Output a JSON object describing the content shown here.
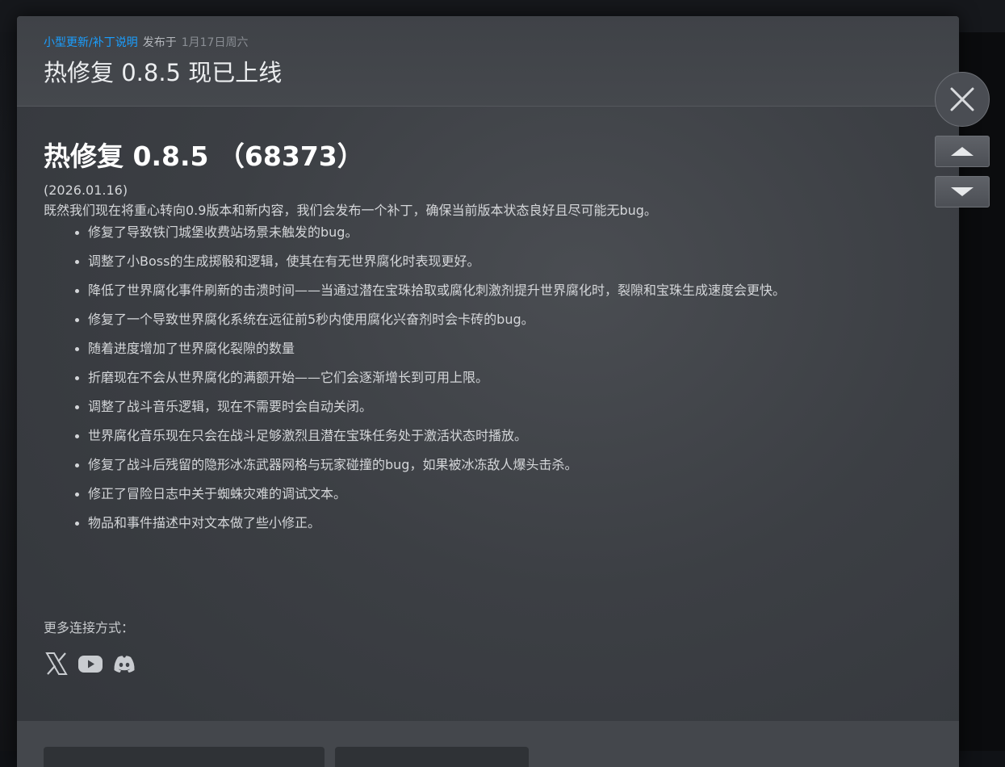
{
  "header": {
    "category": "小型更新/补丁说明",
    "published_label": "发布于",
    "published_date": "1月17日周六",
    "title": "热修复 0.8.5 现已上线"
  },
  "post": {
    "title": "热修复 0.8.5 （68373）",
    "date": "(2026.01.16)",
    "intro": "既然我们现在将重心转向0.9版本和新内容，我们会发布一个补丁，确保当前版本状态良好且尽可能无bug。",
    "notes": [
      "修复了导致铁门城堡收费站场景未触发的bug。",
      "调整了小Boss的生成掷骰和逻辑，使其在有无世界腐化时表现更好。",
      "降低了世界腐化事件刷新的击溃时间——当通过潜在宝珠拾取或腐化刺激剂提升世界腐化时，裂隙和宝珠生成速度会更快。",
      "修复了一个导致世界腐化系统在远征前5秒内使用腐化兴奋剂时会卡砖的bug。",
      "随着进度增加了世界腐化裂隙的数量",
      "折磨现在不会从世界腐化的满额开始——它们会逐渐增长到可用上限。",
      "调整了战斗音乐逻辑，现在不需要时会自动关闭。",
      "世界腐化音乐现在只会在战斗足够激烈且潜在宝珠任务处于激活状态时播放。",
      "修复了战斗后残留的隐形冰冻武器网格与玩家碰撞的bug，如果被冰冻敌人爆头击杀。",
      "修正了冒险日志中关于蜘蛛灾难的调试文本。",
      "物品和事件描述中对文本做了些小修正。"
    ]
  },
  "social": {
    "label": "更多连接方式：",
    "icons": [
      "x-icon",
      "youtube-icon",
      "discord-icon"
    ]
  },
  "controls": {
    "close": "close-icon",
    "prev": "chevron-up-icon",
    "next": "chevron-down-icon"
  },
  "colors": {
    "link": "#1a9fff",
    "title": "#ffffff",
    "text": "#d4d6d9"
  }
}
